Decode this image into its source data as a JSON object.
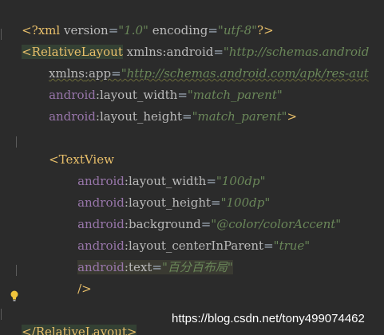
{
  "editor": {
    "lines": {
      "l1": {
        "prefix": "<?",
        "tag": "xml",
        "a1": "version",
        "eq1": "=",
        "v1": "\"1.0\"",
        "a2": "encoding",
        "eq2": "=",
        "v2": "\"utf-8\"",
        "suffix": "?>"
      },
      "l2": {
        "open": "<",
        "tag": "RelativeLayout",
        "ns": "xmlns",
        "colon": ":",
        "attr": "android",
        "eq": "=",
        "val": "\"http://schemas.android"
      },
      "l3": {
        "ns": "xmlns",
        "colon": ":",
        "attr": "app",
        "eq": "=",
        "val": "\"http://schemas.android.com/apk/res-aut"
      },
      "l4": {
        "ns": "android",
        "colon": ":",
        "attr": "layout_width",
        "eq": "=",
        "val": "\"match_parent\""
      },
      "l5": {
        "ns": "android",
        "colon": ":",
        "attr": "layout_height",
        "eq": "=",
        "val": "\"match_parent\"",
        "close": ">"
      },
      "l7": {
        "open": "<",
        "tag": "TextView"
      },
      "l8": {
        "ns": "android",
        "colon": ":",
        "attr": "layout_width",
        "eq": "=",
        "val": "\"100dp\""
      },
      "l9": {
        "ns": "android",
        "colon": ":",
        "attr": "layout_height",
        "eq": "=",
        "val": "\"100dp\""
      },
      "l10": {
        "ns": "android",
        "colon": ":",
        "attr": "background",
        "eq": "=",
        "val": "\"@color/colorAccent\""
      },
      "l11": {
        "ns": "android",
        "colon": ":",
        "attr": "layout_centerInParent",
        "eq": "=",
        "val": "\"true\""
      },
      "l12": {
        "ns": "android",
        "colon": ":",
        "attr": "text",
        "eq": "=",
        "val": "\"百分百布局\""
      },
      "l13": {
        "close": "/>"
      },
      "l15": {
        "open": "</",
        "tag": "RelativeLayout",
        "close": ">"
      }
    },
    "gutter_icon": "lightbulb-icon"
  },
  "watermark": {
    "text": "https://blog.csdn.net/tony499074462"
  },
  "colors": {
    "background": "#2b2b2b",
    "tag": "#e8bf6a",
    "namespace": "#9876aa",
    "attribute": "#bababa",
    "string": "#6a8759",
    "tag_highlight": "#344134",
    "line_highlight": "#3a3a32"
  }
}
